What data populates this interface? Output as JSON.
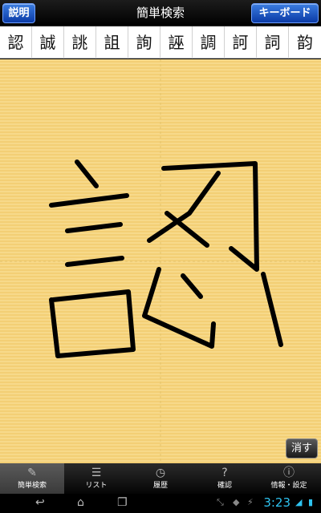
{
  "navbar": {
    "title": "簡単検索",
    "left_button": "説明",
    "right_button": "キーボード"
  },
  "candidates": [
    "認",
    "誠",
    "誂",
    "詛",
    "詢",
    "誣",
    "調",
    "訶",
    "詞",
    "韵"
  ],
  "pad": {
    "clear_button": "消す",
    "strokes_icon": "handwritten-strokes"
  },
  "tabs": [
    {
      "label": "簡単検索",
      "icon": "pencil-icon",
      "active": true
    },
    {
      "label": "リスト",
      "icon": "list-icon",
      "active": false
    },
    {
      "label": "履歴",
      "icon": "clock-icon",
      "active": false
    },
    {
      "label": "確認",
      "icon": "question-icon",
      "active": false
    },
    {
      "label": "情報・設定",
      "icon": "info-icon",
      "active": false
    }
  ],
  "system": {
    "time": "3:23"
  },
  "colors": {
    "accent": "#2ec3f0",
    "button_blue": "#1a52c8",
    "pad_yellow": "#f5d47f"
  }
}
